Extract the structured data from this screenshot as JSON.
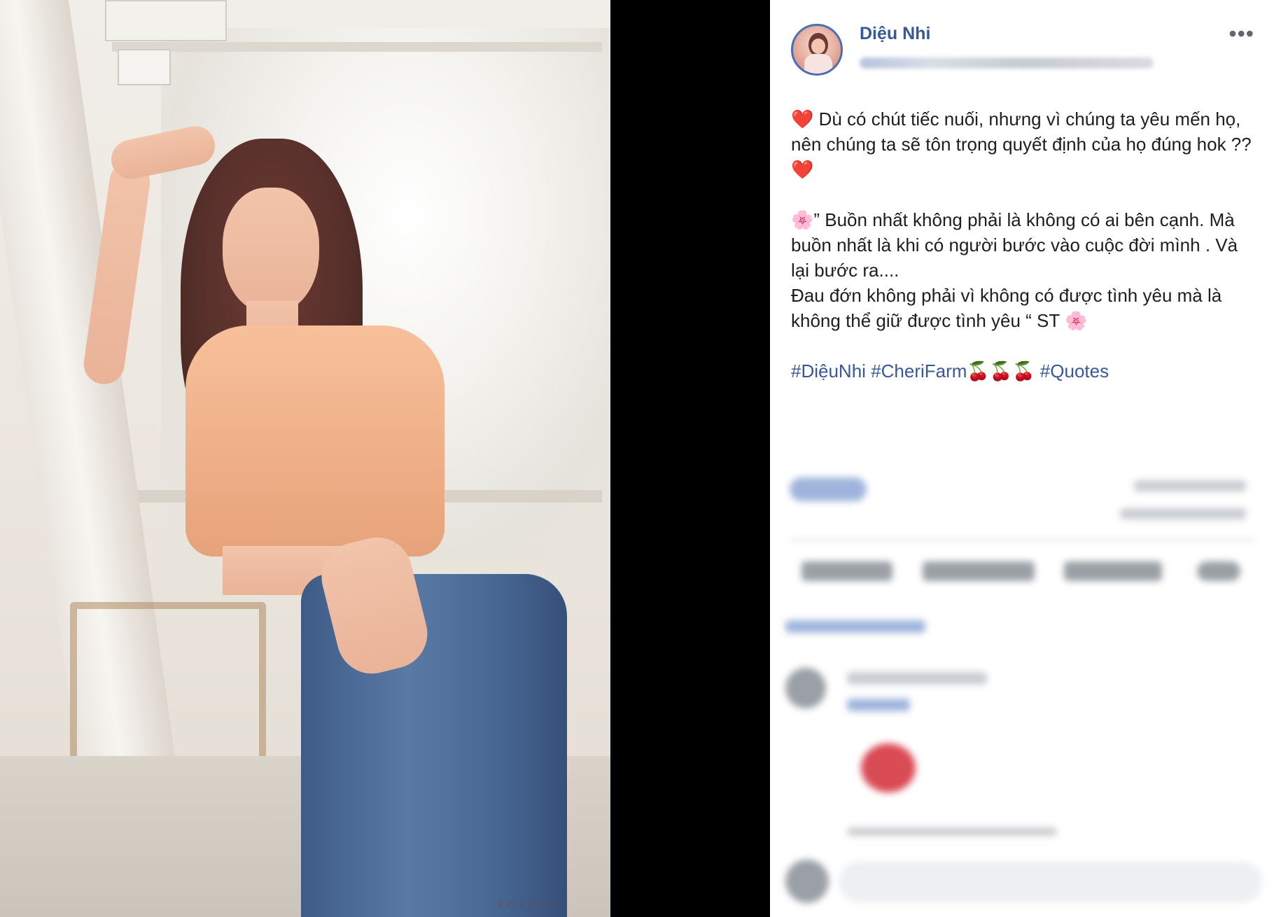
{
  "photo": {
    "watermark": "ROSENG"
  },
  "post": {
    "author": "Diệu Nhi",
    "more_icon": "more-horizontal-icon",
    "paragraphs": [
      "❤️ Dù có chút tiếc nuối, nhưng vì chúng ta yêu mến họ, nên chúng ta sẽ tôn trọng quyết định của họ đúng hok ?? ❤️",
      "🌸” Buồn nhất không phải là không có ai bên cạnh. Mà buồn nhất là khi có người bước vào cuộc đời mình . Và lại bước ra....\nĐau đớn không phải vì không có được tình yêu mà là không thể giữ được tình yêu “ ST 🌸"
    ],
    "hashtags": [
      "#DiệuNhi",
      "#CheriFarm🍒🍒🍒",
      "#Quotes"
    ]
  },
  "colors": {
    "link_blue": "#385898",
    "avatar_ring": "#4a6fb5"
  }
}
